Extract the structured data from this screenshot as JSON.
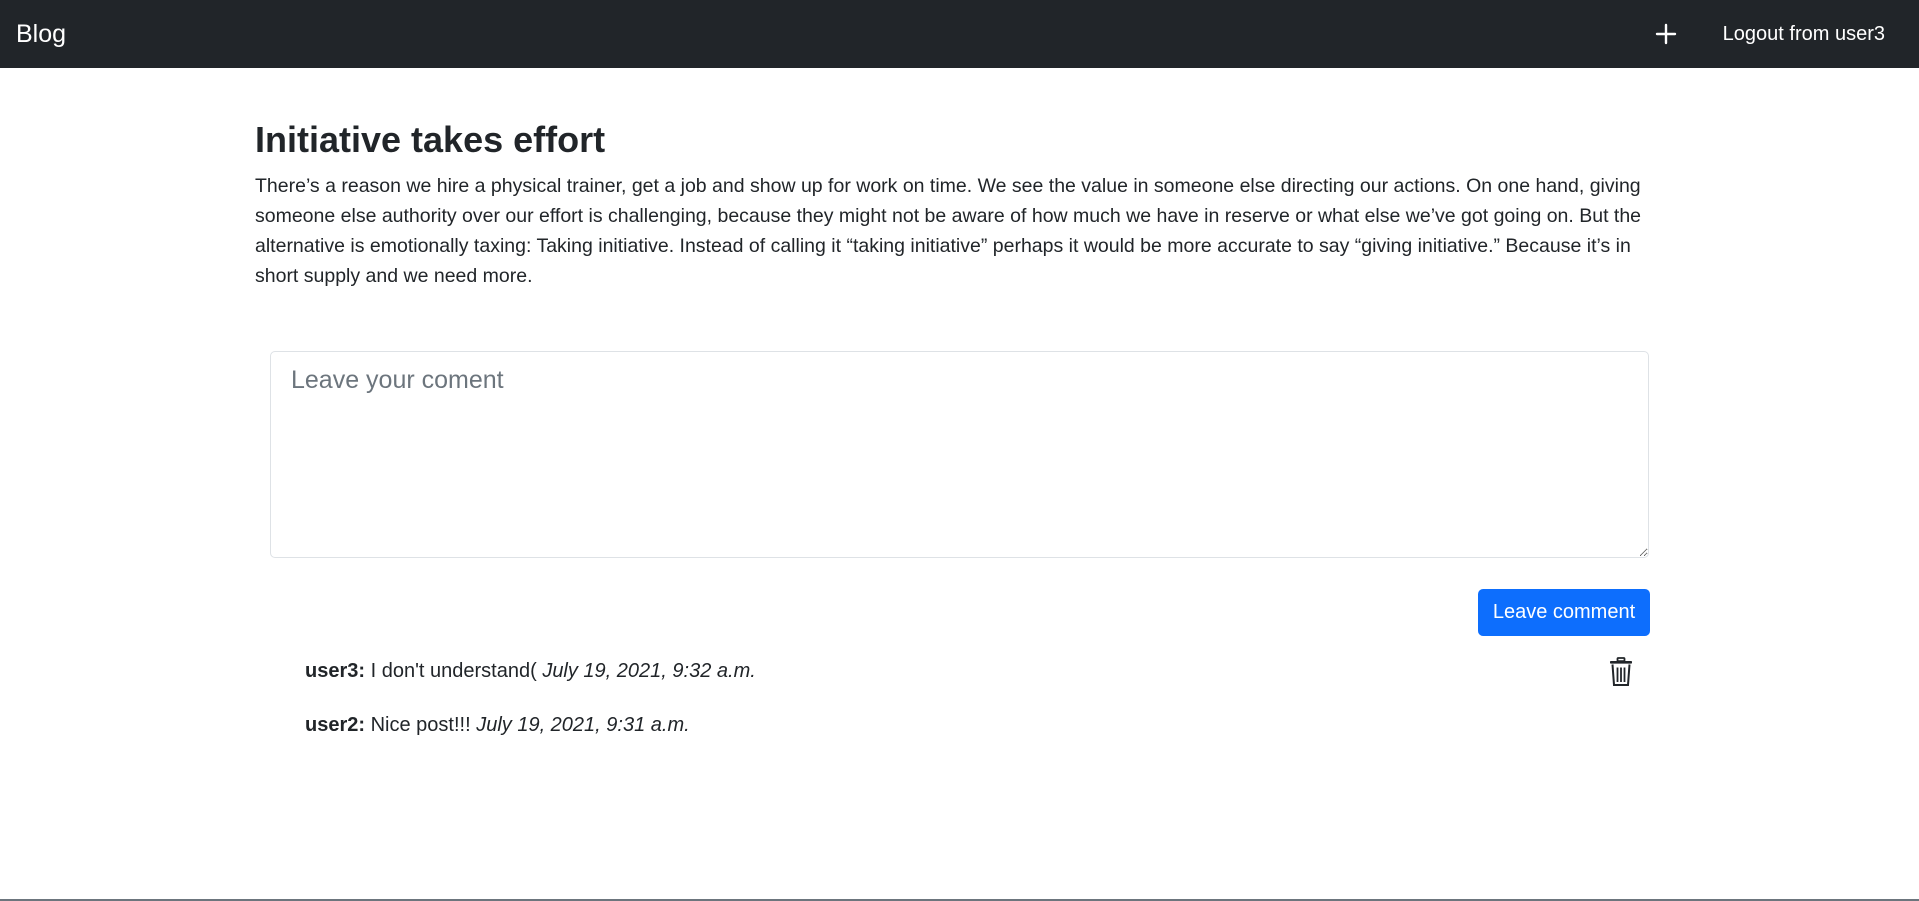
{
  "navbar": {
    "brand": "Blog",
    "add_icon": "plus-icon",
    "logout_label": "Logout from user3"
  },
  "post": {
    "title": "Initiative takes effort",
    "body": "There’s a reason we hire a physical trainer, get a job and show up for work on time. We see the value in someone else directing our actions. On one hand, giving someone else authority over our effort is challenging, because they might not be aware of how much we have in reserve or what else we’ve got going on. But the alternative is emotionally taxing: Taking initiative. Instead of calling it “taking initiative” perhaps it would be more accurate to say “giving initiative.” Because it’s in short supply and we need more."
  },
  "comment_form": {
    "placeholder": "Leave your coment",
    "value": "",
    "submit_label": "Leave comment"
  },
  "comments": [
    {
      "user": "user3:",
      "text": "I don't understand(",
      "date": "July 19, 2021, 9:32 a.m.",
      "delete_icon": "trash-icon"
    },
    {
      "user": "user2:",
      "text": "Nice post!!!",
      "date": "July 19, 2021, 9:31 a.m."
    }
  ],
  "colors": {
    "navbar_bg": "#212529",
    "primary": "#0d6efd",
    "text": "#212529",
    "placeholder": "#6c757d"
  }
}
